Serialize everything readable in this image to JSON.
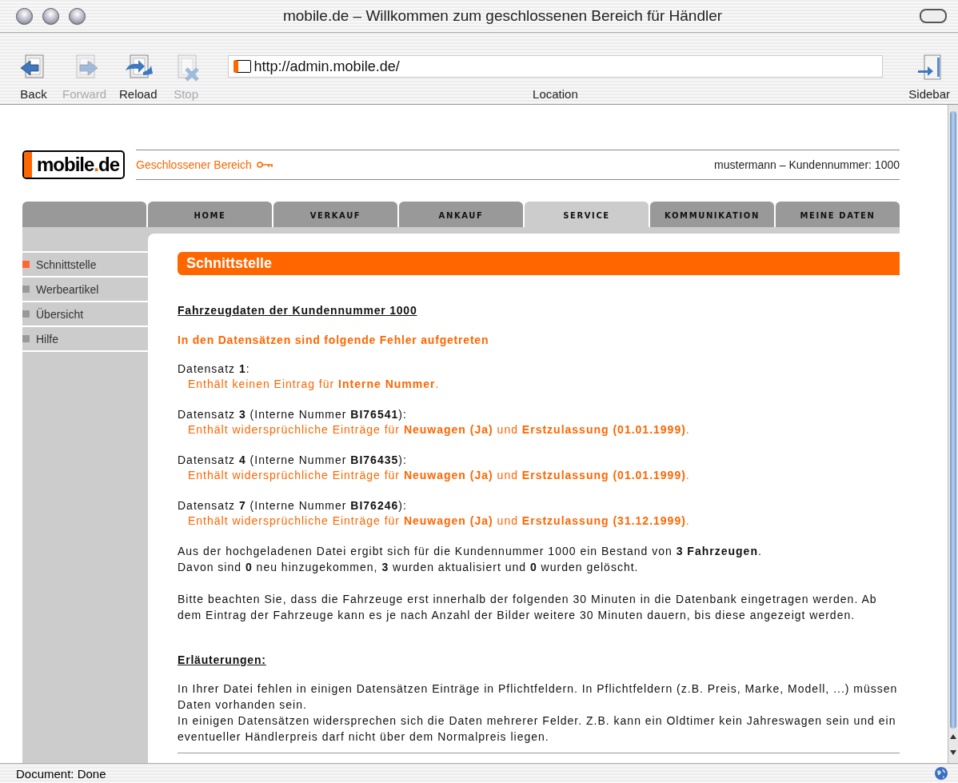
{
  "window": {
    "title": "mobile.de – Willkommen zum geschlossenen Bereich für Händler"
  },
  "toolbar": {
    "buttons": [
      {
        "kind": "back",
        "label": "Back",
        "disabled": false
      },
      {
        "kind": "forward",
        "label": "Forward",
        "disabled": true
      },
      {
        "kind": "reload",
        "label": "Reload",
        "disabled": false
      },
      {
        "kind": "stop",
        "label": "Stop",
        "disabled": true
      }
    ],
    "location": {
      "label": "Location",
      "url": "http://admin.mobile.de/"
    },
    "sidebar_button": {
      "label": "Sidebar"
    }
  },
  "site": {
    "logo": [
      {
        "text": "mobile",
        "accent": false
      },
      {
        "text": ".",
        "accent": true
      },
      {
        "text": "de",
        "accent": false
      }
    ],
    "area": "Geschlossener Bereich",
    "user": "mustermann – Kundennummer: 1000",
    "tabs": [
      {
        "label": "HOME",
        "selected": false
      },
      {
        "label": "VERKAUF",
        "selected": false
      },
      {
        "label": "ANKAUF",
        "selected": false
      },
      {
        "label": "SERVICE",
        "selected": true
      },
      {
        "label": "KOMMUNIKATION",
        "selected": false
      },
      {
        "label": "MEINE DATEN",
        "selected": false
      }
    ],
    "sidebar": [
      {
        "label": "Schnittstelle",
        "selected": true
      },
      {
        "label": "Werbeartikel",
        "selected": false
      },
      {
        "label": "Übersicht",
        "selected": false
      },
      {
        "label": "Hilfe",
        "selected": false
      }
    ]
  },
  "content": {
    "title": "Schnittstelle",
    "heading": "Fahrzeugdaten der Kundennummer 1000",
    "error_heading": "In den Datensätzen sind folgende Fehler aufgetreten",
    "records": [
      {
        "head": "Datensatz **1**:",
        "message": "Enthält keinen Eintrag für **Interne Nummer**."
      },
      {
        "head": "Datensatz **3** (Interne Nummer **BI76541**):",
        "message": "Enthält widersprüchliche Einträge für **Neuwagen (Ja)** und **Erstzulassung (01.01.1999)**."
      },
      {
        "head": "Datensatz **4** (Interne Nummer **BI76435**):",
        "message": "Enthält widersprüchliche Einträge für **Neuwagen (Ja)** und **Erstzulassung (01.01.1999)**."
      },
      {
        "head": "Datensatz **7** (Interne Nummer **BI76246**):",
        "message": "Enthält widersprüchliche Einträge für **Neuwagen (Ja)** und **Erstzulassung (31.12.1999)**."
      }
    ],
    "summary": [
      "Aus der hochgeladenen Datei ergibt sich für die Kundennummer 1000 ein Bestand von **3 Fahrzeugen**.",
      "Davon sind **0** neu hinzugekommen, **3** wurden aktualisiert und **0** wurden gelöscht."
    ],
    "notice": "Bitte beachten Sie, dass die Fahrzeuge erst innerhalb der folgenden 30 Minuten in die Datenbank eingetragen werden. Ab dem Eintrag der Fahrzeuge kann es je nach Anzahl der Bilder weitere 30 Minuten dauern, bis diese angezeigt werden.",
    "explanations_heading": "Erläuterungen:",
    "explanations": [
      "In Ihrer Datei fehlen in einigen Datensätzen Einträge in Pflichtfeldern. In Pflichtfeldern (z.B. Preis, Marke, Modell, ...) müssen Daten vorhanden sein.",
      "In einigen Datensätzen widersprechen sich die Daten mehrerer Felder. Z.B. kann ein Oldtimer kein Jahreswagen sein und ein eventueller Händlerpreis darf nicht über dem Normalpreis liegen."
    ]
  },
  "status_bar": {
    "text": "Document: Done"
  }
}
